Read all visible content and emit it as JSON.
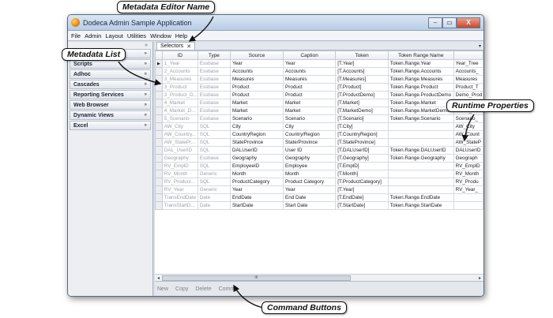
{
  "window": {
    "title": "Dodeca Admin Sample Application",
    "min": "–",
    "max": "▭",
    "close": "X"
  },
  "menu": [
    "File",
    "Admin",
    "Layout",
    "Utilities",
    "Window",
    "Help"
  ],
  "sidebar": {
    "pin": "»",
    "items": [
      {
        "label": "",
        "chev": "»"
      },
      {
        "label": "Scripts",
        "chev": "»"
      },
      {
        "label": "Adhoc",
        "chev": "»"
      },
      {
        "label": "Cascades",
        "chev": "»"
      },
      {
        "label": "Reporting Services",
        "chev": "»"
      },
      {
        "label": "Web Browser",
        "chev": "»"
      },
      {
        "label": "Dynamic Views",
        "chev": "»"
      },
      {
        "label": "Excel",
        "chev": "»"
      }
    ]
  },
  "tab": {
    "label": "Selectors",
    "close": "✕",
    "menu": "▾"
  },
  "grid": {
    "columns": [
      "ID",
      "Type",
      "Source",
      "Caption",
      "Token",
      "Token Range Name",
      ""
    ],
    "rows": [
      [
        "1_Year",
        "Essbase",
        "Year",
        "Year",
        "[T.Year]",
        "Token.Range.Year",
        "Year_Tree"
      ],
      [
        "2_Accounts",
        "Essbase",
        "Accounts",
        "Accounts",
        "[T.Accounts]",
        "Token.Range.Accounts",
        "Accounts_"
      ],
      [
        "3_Measures",
        "Essbase",
        "Measures",
        "Measures",
        "[T.Measures]",
        "Token.Range.Measures",
        "Measures"
      ],
      [
        "3_Product",
        "Essbase",
        "Product",
        "Product",
        "[T.Product]",
        "Token.Range.Product",
        "Product_T"
      ],
      [
        "3_Product_D...",
        "Essbase",
        "Product",
        "Product",
        "[T.ProductDemo]",
        "Token.Range.ProductDemo",
        "Demo_Prod"
      ],
      [
        "4_Market",
        "Essbase",
        "Market",
        "Market",
        "[T.Market]",
        "Token.Range.Market",
        "Market_Tr"
      ],
      [
        "4_Market_D...",
        "Essbase",
        "Market",
        "Market",
        "[T.MarketDemo]",
        "Token.Range.MarketDemo",
        "Demo_Mark"
      ],
      [
        "5_Scenario",
        "Essbase",
        "Scenario",
        "Scenario",
        "[T.Scenario]",
        "Token.Range.Scenario",
        "Scenario_"
      ],
      [
        "AW_City",
        "SQL",
        "City",
        "City",
        "[T.City]",
        "",
        "AW_City"
      ],
      [
        "AW_Country...",
        "SQL",
        "CountryRegion",
        "Country/Region",
        "[T.CountryRegion]",
        "",
        "AW_Count"
      ],
      [
        "AW_StatePr...",
        "SQL",
        "StateProvince",
        "State/Province",
        "[T.StateProvince]",
        "",
        "AW_StateP"
      ],
      [
        "DAL_UserID",
        "SQL",
        "DALUserID",
        "User ID",
        "[T.DALUserID]",
        "Token.Range.DALUserID",
        "DALUserID"
      ],
      [
        "Geography",
        "Essbase",
        "Geography",
        "Geography",
        "[T.Geography]",
        "Token.Range.Geography",
        "Geograph"
      ],
      [
        "RV_EmplD",
        "SQL",
        "EmployeeID",
        "Employee",
        "[T.EmplD]",
        "",
        "RV_EmplD"
      ],
      [
        "RV_Month",
        "Generic",
        "Month",
        "Month",
        "[T.Month]",
        "",
        "RV_Month"
      ],
      [
        "RV_Product...",
        "SQL",
        "ProductCategory",
        "Product Category",
        "[T.ProductCategory]",
        "",
        "RV_Produ"
      ],
      [
        "RV_Year",
        "Generic",
        "Year",
        "Year",
        "[T.Year]",
        "",
        "RV_Year_"
      ],
      [
        "TransEndDate",
        "Date",
        "EndDate",
        "End Date",
        "[T.EndDate]",
        "Token.Range.EndDate",
        ""
      ],
      [
        "TransStartD...",
        "Date",
        "StartDate",
        "Start Date",
        "[T.StartDate]",
        "Token.Range.StartDate",
        ""
      ]
    ],
    "selected_marker": "▶"
  },
  "scroll": {
    "left": "◂",
    "right": "▸",
    "thumb": "III"
  },
  "commands": [
    "New",
    "Copy",
    "Delete",
    "Commit"
  ],
  "callouts": {
    "editor_name": "Metadata Editor Name",
    "list": "Metadata List",
    "runtime": "Runtime Properties",
    "commands": "Command Buttons"
  }
}
